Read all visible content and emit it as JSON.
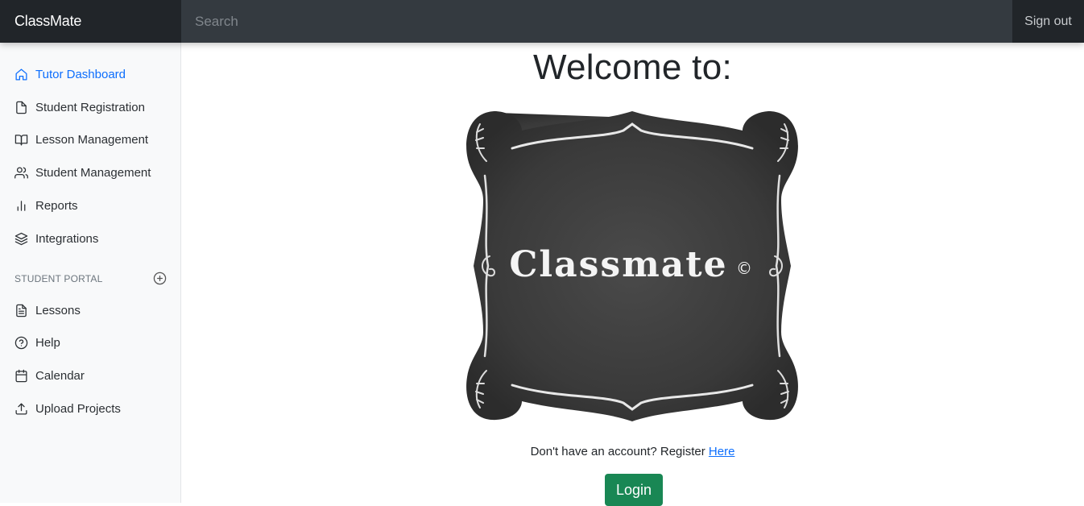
{
  "header": {
    "brand": "ClassMate",
    "search_placeholder": "Search",
    "sign_out": "Sign out"
  },
  "sidebar": {
    "items": [
      {
        "label": "Tutor Dashboard",
        "icon": "home-icon",
        "active": true
      },
      {
        "label": "Student Registration",
        "icon": "file-icon"
      },
      {
        "label": "Lesson Management",
        "icon": "book-icon"
      },
      {
        "label": "Student Management",
        "icon": "users-icon"
      },
      {
        "label": "Reports",
        "icon": "bar-chart-icon"
      },
      {
        "label": "Integrations",
        "icon": "layers-icon"
      }
    ],
    "section_title": "STUDENT PORTAL",
    "portal_items": [
      {
        "label": "Lessons",
        "icon": "file-text-icon"
      },
      {
        "label": "Help",
        "icon": "help-circle-icon"
      },
      {
        "label": "Calendar",
        "icon": "calendar-icon"
      },
      {
        "label": "Upload Projects",
        "icon": "upload-icon"
      }
    ]
  },
  "main": {
    "title": "Welcome to:",
    "logo_text": "Classmate",
    "logo_mark": "©",
    "register_text": "Don't have an account? Register",
    "register_link": "Here",
    "login_label": "Login"
  },
  "colors": {
    "navbar": "#343a40",
    "brand_bg": "#212529",
    "active_link": "#0d6efd",
    "login_button": "#198754",
    "chalkboard": "#3a3a3a"
  }
}
